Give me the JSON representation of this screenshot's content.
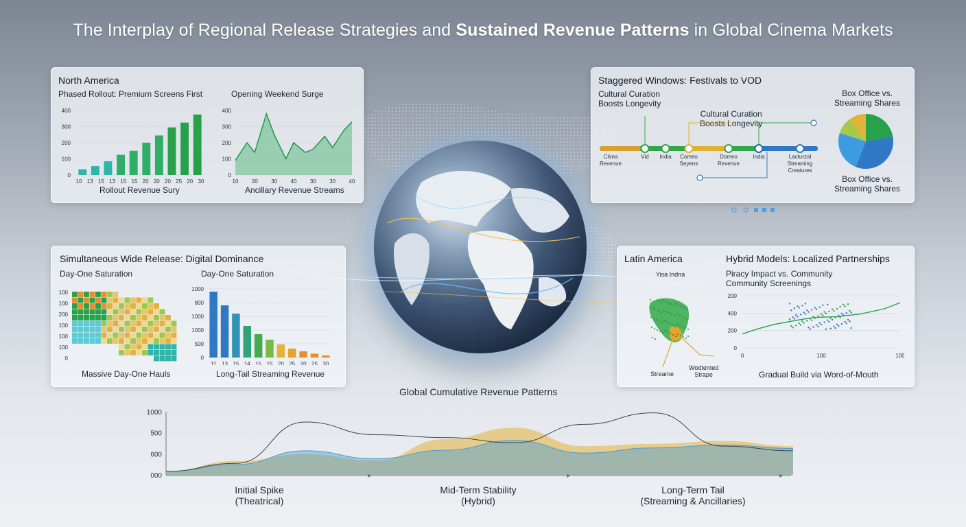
{
  "title": {
    "part1": "The Interplay of Regional Release Strategies and ",
    "part2": "Sustained Revenue Patterns",
    "part3": " in Global Cinema Markets"
  },
  "na_panel": {
    "heading": "North America",
    "left_title": "Phased Rollout: Premium Screens First",
    "right_title": "Opening Weekend Surge",
    "left_caption": "Rollout Revenue Sury",
    "right_caption": "Ancillary Revenue Streams"
  },
  "sw_panel": {
    "heading": "Staggered Windows: Festivals to VOD",
    "label_a": "Cultural Curation\nBoosts Longevity",
    "label_b": "Cultural Curation\nBoosts Longevity",
    "pie_title_top": "Box Office vs.\nStreaming Shares",
    "pie_title_bottom": "Box Office vs.\nStreaming Shares",
    "timeline_labels": [
      "China\nRevenue",
      "Vid",
      "India",
      "Comeo\nSeyens",
      "Domeo\nRevenue",
      "India",
      "Lacturzal\nStreaming\nCreatures"
    ]
  },
  "sim_panel": {
    "heading": "Simultaneous Wide Release: Digital Dominance",
    "left_title": "Day-One Saturation",
    "right_title": "Day-One Saturation",
    "left_caption": "Massive Day-One Hauls",
    "right_caption": "Long-Tail Streaming Revenue"
  },
  "la_panel": {
    "heading": "Latin America",
    "right_heading": "Hybrid Models: Localized Partnerships",
    "map_label": "Yisa Indna",
    "map_callout_left": "Streame",
    "map_callout_right": "Wodtented\nStrape",
    "scatter_title": "Piracy Impact vs. Community\nCommunity Screenings",
    "scatter_caption": "Gradual Build via Word-of-Mouth"
  },
  "global": {
    "title": "Global Cumulative Revenue Patterns",
    "phase1": "Initial Spike\n(Theatrical)",
    "phase2": "Mid-Term Stability\n(Hybrid)",
    "phase3": "Long-Term Tail\n(Streaming & Ancillaries)"
  },
  "colors": {
    "green": "#27a24a",
    "teal": "#2fb5a8",
    "blue": "#2e78c4",
    "gold": "#e3b23a",
    "orange": "#e58f2c"
  },
  "chart_data": [
    {
      "type": "bar",
      "name": "rollout",
      "categories": [
        "10",
        "13",
        "15",
        "13",
        "15",
        "15",
        "20",
        "20",
        "20",
        "25",
        "20",
        "30"
      ],
      "values": [
        35,
        55,
        85,
        125,
        150,
        200,
        245,
        295,
        325,
        375
      ],
      "yticks": [
        "0",
        "100",
        "200",
        "300",
        "400"
      ],
      "xticks": [
        "10",
        "13",
        "15",
        "13",
        "15",
        "15",
        "20",
        "20",
        "20",
        "25",
        "20",
        "30"
      ],
      "ylim": [
        0,
        400
      ]
    },
    {
      "type": "area",
      "name": "opening-weekend",
      "x": [
        10,
        13,
        15,
        18,
        20,
        23,
        25,
        28,
        30,
        33,
        35,
        38,
        40
      ],
      "values": [
        90,
        200,
        140,
        380,
        250,
        100,
        200,
        140,
        160,
        240,
        170,
        280,
        330
      ],
      "yticks": [
        "0",
        "100",
        "200",
        "300",
        "400"
      ],
      "xticks": [
        "10",
        "20",
        "30",
        "40",
        "30",
        "30",
        "40"
      ],
      "ylim": [
        0,
        400
      ]
    },
    {
      "type": "pie",
      "name": "box-office-vs-streaming",
      "values": [
        22,
        34,
        24,
        10,
        10
      ],
      "colors": [
        "#27a24a",
        "#2e78c4",
        "#3d9be0",
        "#a6c94a",
        "#e3b23a"
      ]
    },
    {
      "type": "heatmap",
      "name": "day-one-saturation",
      "yticks": [
        "0",
        "100",
        "100",
        "100",
        "200",
        "100",
        "100"
      ]
    },
    {
      "type": "bar",
      "name": "long-tail",
      "categories": [
        "11",
        "13",
        "15",
        "14",
        "15",
        "15",
        "20",
        "25",
        "20",
        "25",
        "30"
      ],
      "values": [
        960,
        760,
        640,
        460,
        340,
        260,
        190,
        130,
        90,
        55,
        30
      ],
      "yticks": [
        "0",
        "500",
        "1000",
        "1000",
        "800",
        "1000"
      ],
      "xticks": [
        "11",
        "13",
        "15",
        "14",
        "15",
        "15",
        "20",
        "25",
        "20",
        "25",
        "30"
      ],
      "ylim": [
        0,
        1000
      ]
    },
    {
      "type": "scatter",
      "name": "piracy-vs-community",
      "yticks": [
        "200",
        "400",
        "200",
        "0"
      ],
      "xticks": [
        "0",
        "100",
        "100"
      ],
      "trend": [
        [
          0,
          80
        ],
        [
          10,
          110
        ],
        [
          20,
          135
        ],
        [
          35,
          160
        ],
        [
          45,
          175
        ],
        [
          60,
          180
        ],
        [
          75,
          195
        ],
        [
          90,
          225
        ],
        [
          100,
          260
        ]
      ]
    },
    {
      "type": "area",
      "name": "global-cumulative",
      "yticks": [
        "1000",
        "500",
        "600",
        "000"
      ],
      "series": [
        {
          "values": [
            60,
            200,
            920,
            700,
            650,
            560,
            880,
            1080,
            500,
            420
          ]
        },
        {
          "values": [
            60,
            240,
            360,
            250,
            620,
            820,
            500,
            540,
            590,
            500
          ]
        },
        {
          "values": [
            60,
            180,
            420,
            280,
            430,
            600,
            380,
            470,
            520,
            460
          ]
        }
      ],
      "ylim": [
        0,
        1100
      ]
    }
  ]
}
